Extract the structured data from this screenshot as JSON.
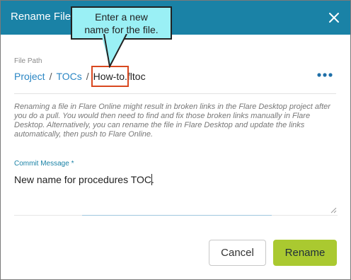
{
  "dialog": {
    "title": "Rename File",
    "close_icon": "close-icon",
    "colors": {
      "header": "#1a82a6",
      "rename_button": "#aac930",
      "link": "#2a86c4",
      "highlight": "#d9481f"
    }
  },
  "file_path": {
    "label": "File Path",
    "crumbs": [
      "Project",
      "TOCs"
    ],
    "separator": "/",
    "file_name": "How-to",
    "file_extension": ".fltoc",
    "more_icon": "more-horizontal-icon"
  },
  "warning_text": "Renaming a file in Flare Online might result in broken links in the Flare Desktop project after you do a pull. You would then need to find and fix those broken links manually in Flare Desktop. Alternatively, you can rename the file in Flare Desktop and update the links automatically, then push to Flare Online.",
  "commit": {
    "label": "Commit Message *",
    "value": "New name for procedures TOC."
  },
  "buttons": {
    "cancel": "Cancel",
    "rename": "Rename"
  },
  "callout": {
    "line1": "Enter a new",
    "line2": "name for the file."
  }
}
